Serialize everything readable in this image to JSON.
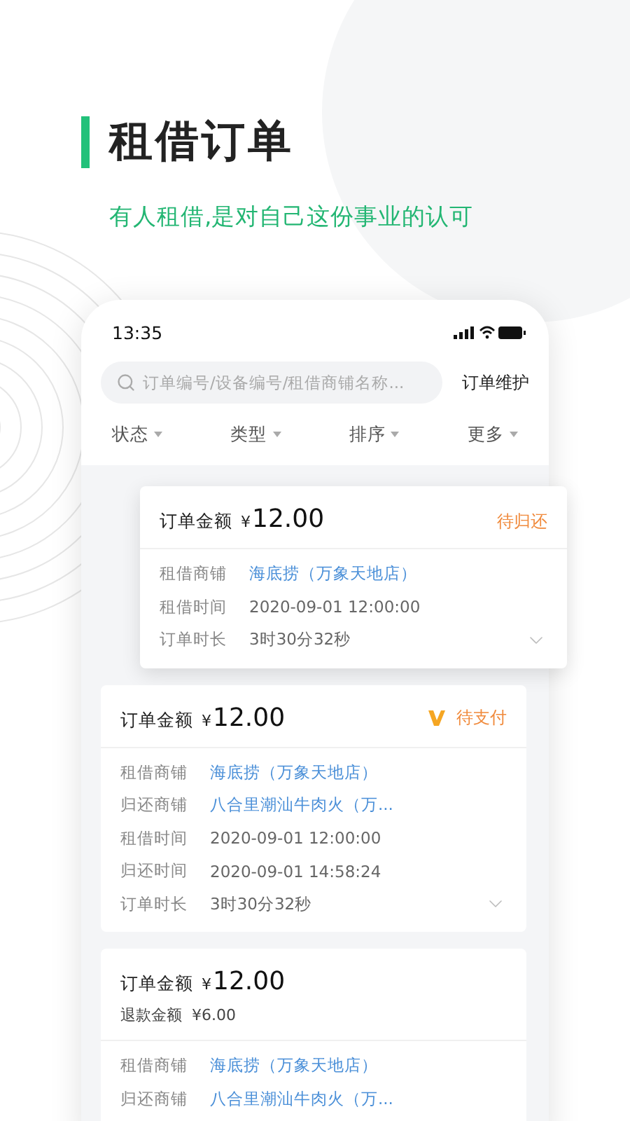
{
  "header": {
    "title": "租借订单",
    "subtitle": "有人租借,是对自己这份事业的认可"
  },
  "phone": {
    "status_bar": {
      "time": "13:35"
    },
    "search": {
      "placeholder": "订单编号/设备编号/租借商铺名称..."
    },
    "action": "订单维护",
    "filters": [
      "状态",
      "类型",
      "排序",
      "更多"
    ],
    "orders": [
      {
        "highlighted": true,
        "amount_label": "订单金额",
        "currency": "¥",
        "amount": "12.00",
        "status": "待归还",
        "status_icon": false,
        "expandable": true,
        "rows": [
          {
            "label": "租借商铺",
            "value": "海底捞（万象天地店）",
            "kind": "link"
          },
          {
            "label": "租借时间",
            "value": "2020-09-01  12:00:00",
            "kind": "plain"
          },
          {
            "label": "订单时长",
            "value": "3时30分32秒",
            "kind": "plain"
          }
        ]
      },
      {
        "highlighted": false,
        "amount_label": "订单金额",
        "currency": "¥",
        "amount": "12.00",
        "status": "待支付",
        "status_icon": true,
        "expandable": true,
        "rows": [
          {
            "label": "租借商铺",
            "value": "海底捞（万象天地店）",
            "kind": "link"
          },
          {
            "label": "归还商铺",
            "value": "八合里潮汕牛肉火（万...",
            "kind": "link"
          },
          {
            "label": "租借时间",
            "value": "2020-09-01  12:00:00",
            "kind": "plain"
          },
          {
            "label": "归还时间",
            "value": "2020-09-01  14:58:24",
            "kind": "plain"
          },
          {
            "label": "订单时长",
            "value": "3时30分32秒",
            "kind": "plain"
          }
        ]
      },
      {
        "highlighted": false,
        "amount_label": "订单金额",
        "currency": "¥",
        "amount": "12.00",
        "refund": {
          "label": "退款金额",
          "value": "¥6.00"
        },
        "rows": [
          {
            "label": "租借商铺",
            "value": "海底捞（万象天地店）",
            "kind": "link"
          },
          {
            "label": "归还商铺",
            "value": "八合里潮汕牛肉火（万...",
            "kind": "link"
          }
        ]
      }
    ]
  }
}
